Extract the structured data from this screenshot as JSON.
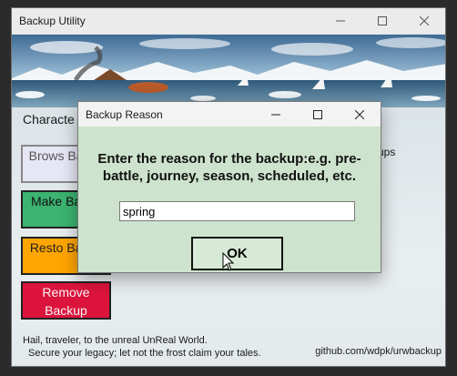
{
  "main_window": {
    "title": "Backup Utility",
    "controls": {
      "minimize": "—",
      "maximize": "☐",
      "close": "✕"
    }
  },
  "character_label": "Characte",
  "side_text": "ups",
  "buttons": {
    "browse": "Brows Backu",
    "make": "Make Backu",
    "restore": "Resto Backu",
    "remove": "Remove Backup"
  },
  "footer": {
    "line1": "Hail, traveler, to the unreal UnReal World.",
    "line2": "Secure your legacy; let not the frost claim your tales.",
    "link": "github.com/wdpk/urwbackup"
  },
  "dialog": {
    "title": "Backup Reason",
    "controls": {
      "minimize": "—",
      "maximize": "☐",
      "close": "✕"
    },
    "prompt": "Enter the reason for the backup:e.g. pre-battle, journey, season, scheduled, etc.",
    "input_value": "spring",
    "ok_label": "OK"
  },
  "colors": {
    "make": "#3cb371",
    "restore": "#ffa500",
    "remove": "#dc143c",
    "browse": "#e6e6f5",
    "dialog_bg": "#cde3cd"
  }
}
